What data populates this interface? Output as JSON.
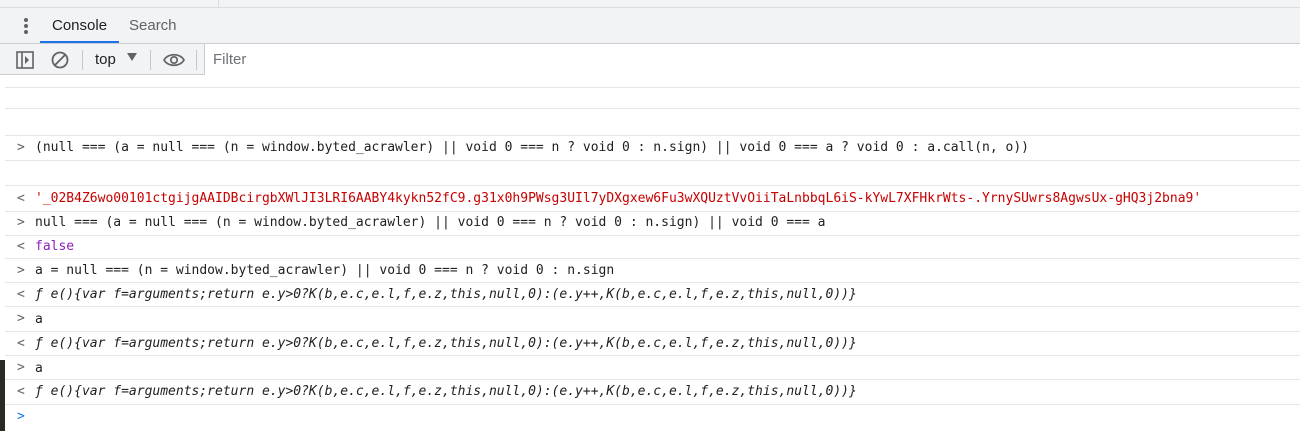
{
  "tabs": [
    {
      "label": "Console",
      "active": true
    },
    {
      "label": "Search",
      "active": false
    }
  ],
  "toolbar": {
    "context": "top",
    "filter_placeholder": "Filter"
  },
  "console": {
    "entries": [
      {
        "kind": "input",
        "prompt": ">",
        "text": "(null === (a = null === (n = window.byted_acrawler) || void 0 === n ? void 0 : n.sign) || void 0 === a ? void 0 : a.call(n, o))"
      },
      {
        "kind": "output",
        "prompt": "<",
        "text": "'_02B4Z6wo00101ctgijgAAIDBcirgbXWlJI3LRI6AABY4kykn52fC9.g31x0h9PWsg3UIl7yDXgxew6Fu3wXQUztVvOiiTaLnbbqL6iS-kYwL7XFHkrWts-.YrnySUwrs8AgwsUx-gHQ3j2bna9'"
      },
      {
        "kind": "input",
        "prompt": ">",
        "text": "null === (a = null === (n = window.byted_acrawler) || void 0 === n ? void 0 : n.sign) || void 0 === a"
      },
      {
        "kind": "output",
        "prompt": "<",
        "text": "false"
      },
      {
        "kind": "input",
        "prompt": ">",
        "text": "a = null === (n = window.byted_acrawler) || void 0 === n ? void 0 : n.sign"
      },
      {
        "kind": "output",
        "prompt": "<",
        "text": "ƒ e(){var f=arguments;return e.y>0?K(b,e.c,e.l,f,e.z,this,null,0):(e.y++,K(b,e.c,e.l,f,e.z,this,null,0))}"
      },
      {
        "kind": "input",
        "prompt": ">",
        "text": "a"
      },
      {
        "kind": "output",
        "prompt": "<",
        "text": "ƒ e(){var f=arguments;return e.y>0?K(b,e.c,e.l,f,e.z,this,null,0):(e.y++,K(b,e.c,e.l,f,e.z,this,null,0))}"
      },
      {
        "kind": "input",
        "prompt": ">",
        "text": "a"
      },
      {
        "kind": "output",
        "prompt": "<",
        "text": "ƒ e(){var f=arguments;return e.y>0?K(b,e.c,e.l,f,e.z,this,null,0):(e.y++,K(b,e.c,e.l,f,e.z,this,null,0))}"
      }
    ],
    "active_prompt": ">"
  },
  "colors": {
    "accent": "#1a73e8",
    "string": "#c80000",
    "keyword": "#8d1ebf",
    "text": "#202124"
  },
  "icons": [
    "more-vertical-icon",
    "sidebar-toggle-icon",
    "clear-console-icon",
    "dropdown-caret-icon",
    "eye-icon"
  ]
}
